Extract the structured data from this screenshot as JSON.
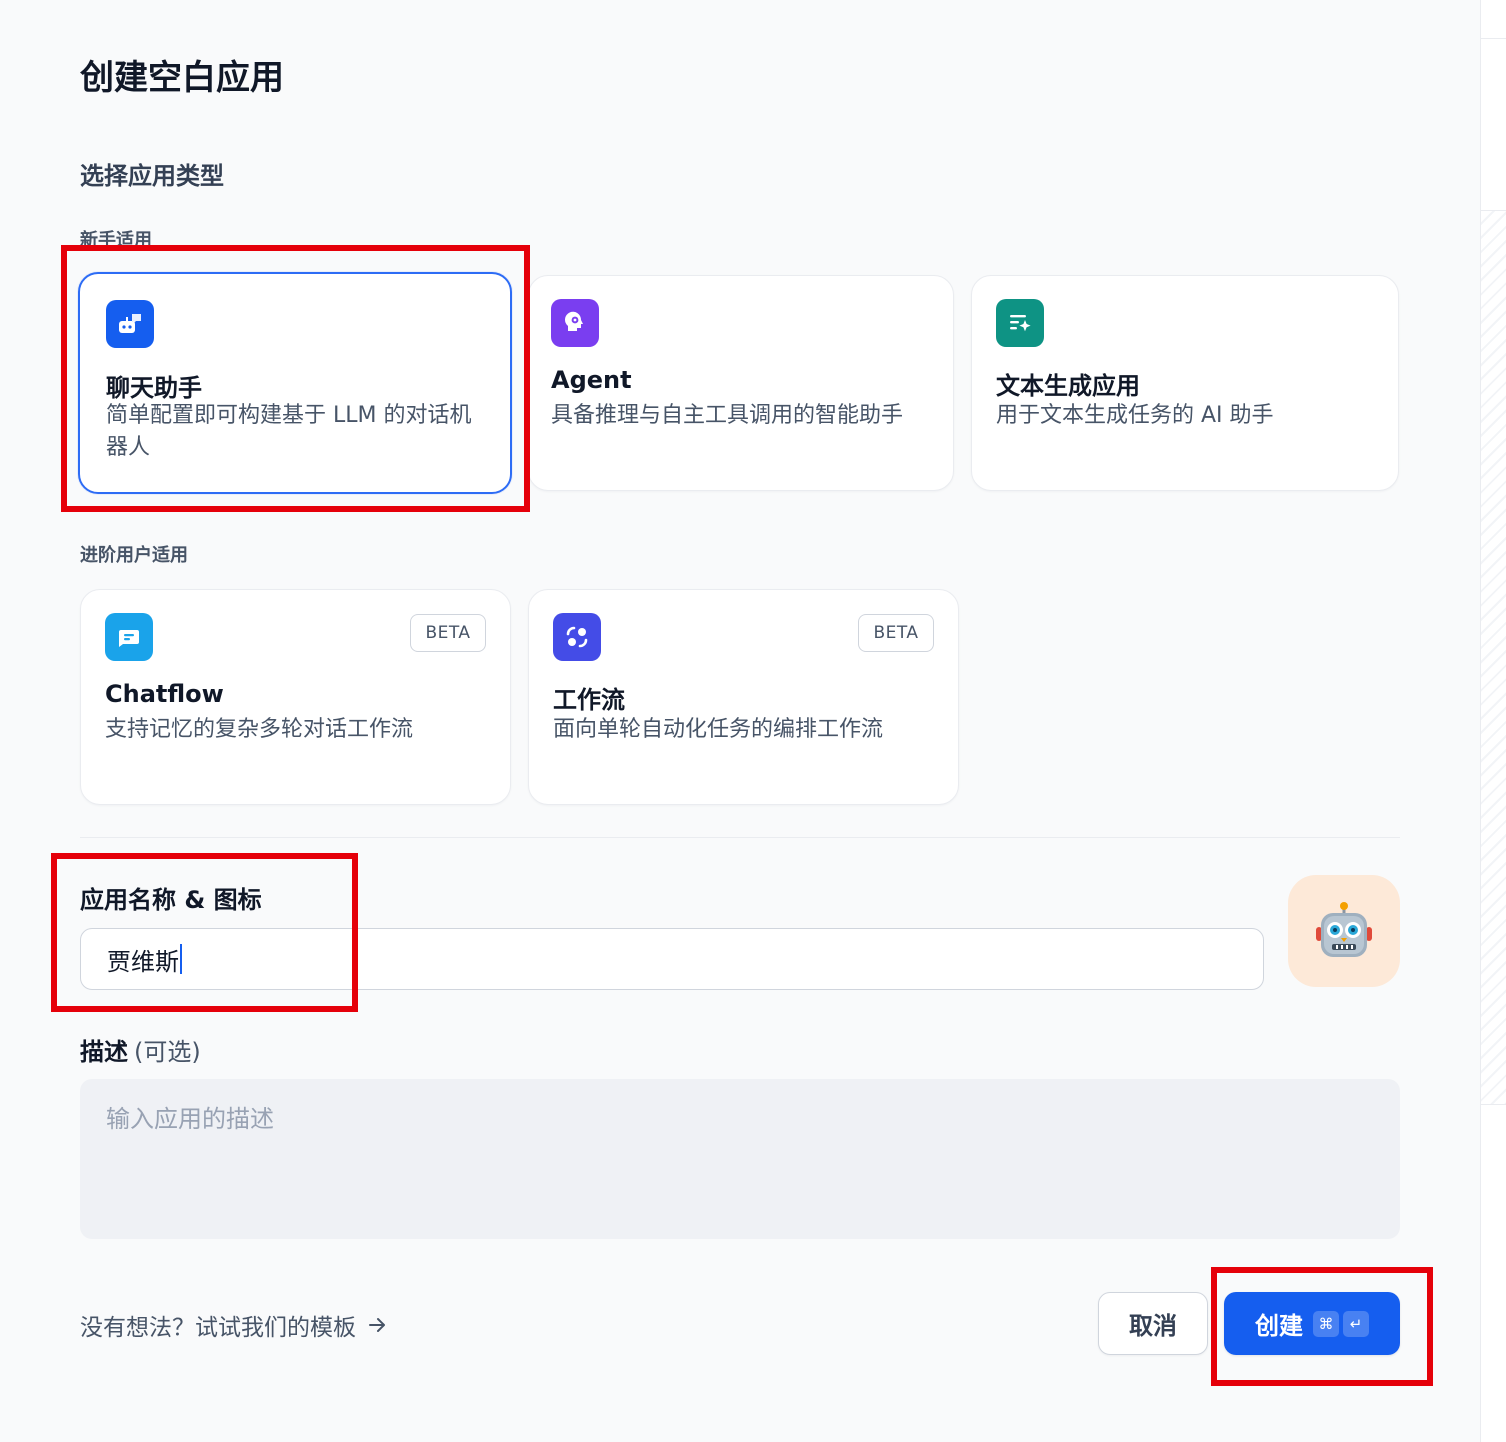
{
  "dialog": {
    "title": "创建空白应用",
    "section_title": "选择应用类型",
    "beginner_label": "新手适用",
    "advanced_label": "进阶用户适用"
  },
  "app_types": {
    "chat": {
      "icon": "chat-bot-icon",
      "title": "聊天助手",
      "description": "简单配置即可构建基于 LLM 的对话机器人",
      "color": "#155eef",
      "selected": true
    },
    "agent": {
      "icon": "agent-brain-icon",
      "title": "Agent",
      "description": "具备推理与自主工具调用的智能助手",
      "color": "#7a3ef0"
    },
    "completion": {
      "icon": "text-sparkle-icon",
      "title": "文本生成应用",
      "description": "用于文本生成任务的 AI 助手",
      "color": "#0e9384"
    },
    "chatflow": {
      "icon": "chatflow-icon",
      "title": "Chatflow",
      "description": "支持记忆的复杂多轮对话工作流",
      "badge": "BETA",
      "color": "#1aa3ea"
    },
    "workflow": {
      "icon": "workflow-icon",
      "title": "工作流",
      "description": "面向单轮自动化任务的编排工作流",
      "badge": "BETA",
      "color": "#444ce7"
    }
  },
  "name_field": {
    "label": "应用名称 & 图标",
    "value": "贾维斯",
    "icon_emoji": "robot-face-emoji",
    "icon_bg": "#fde9d8"
  },
  "description_field": {
    "label": "描述",
    "optional": "(可选)",
    "placeholder": "输入应用的描述"
  },
  "footer": {
    "template_link": "没有想法？试试我们的模板",
    "cancel": "取消",
    "create": "创建",
    "shortcut_cmd": "⌘",
    "shortcut_enter": "↵"
  },
  "highlight_color": "#e5000a"
}
